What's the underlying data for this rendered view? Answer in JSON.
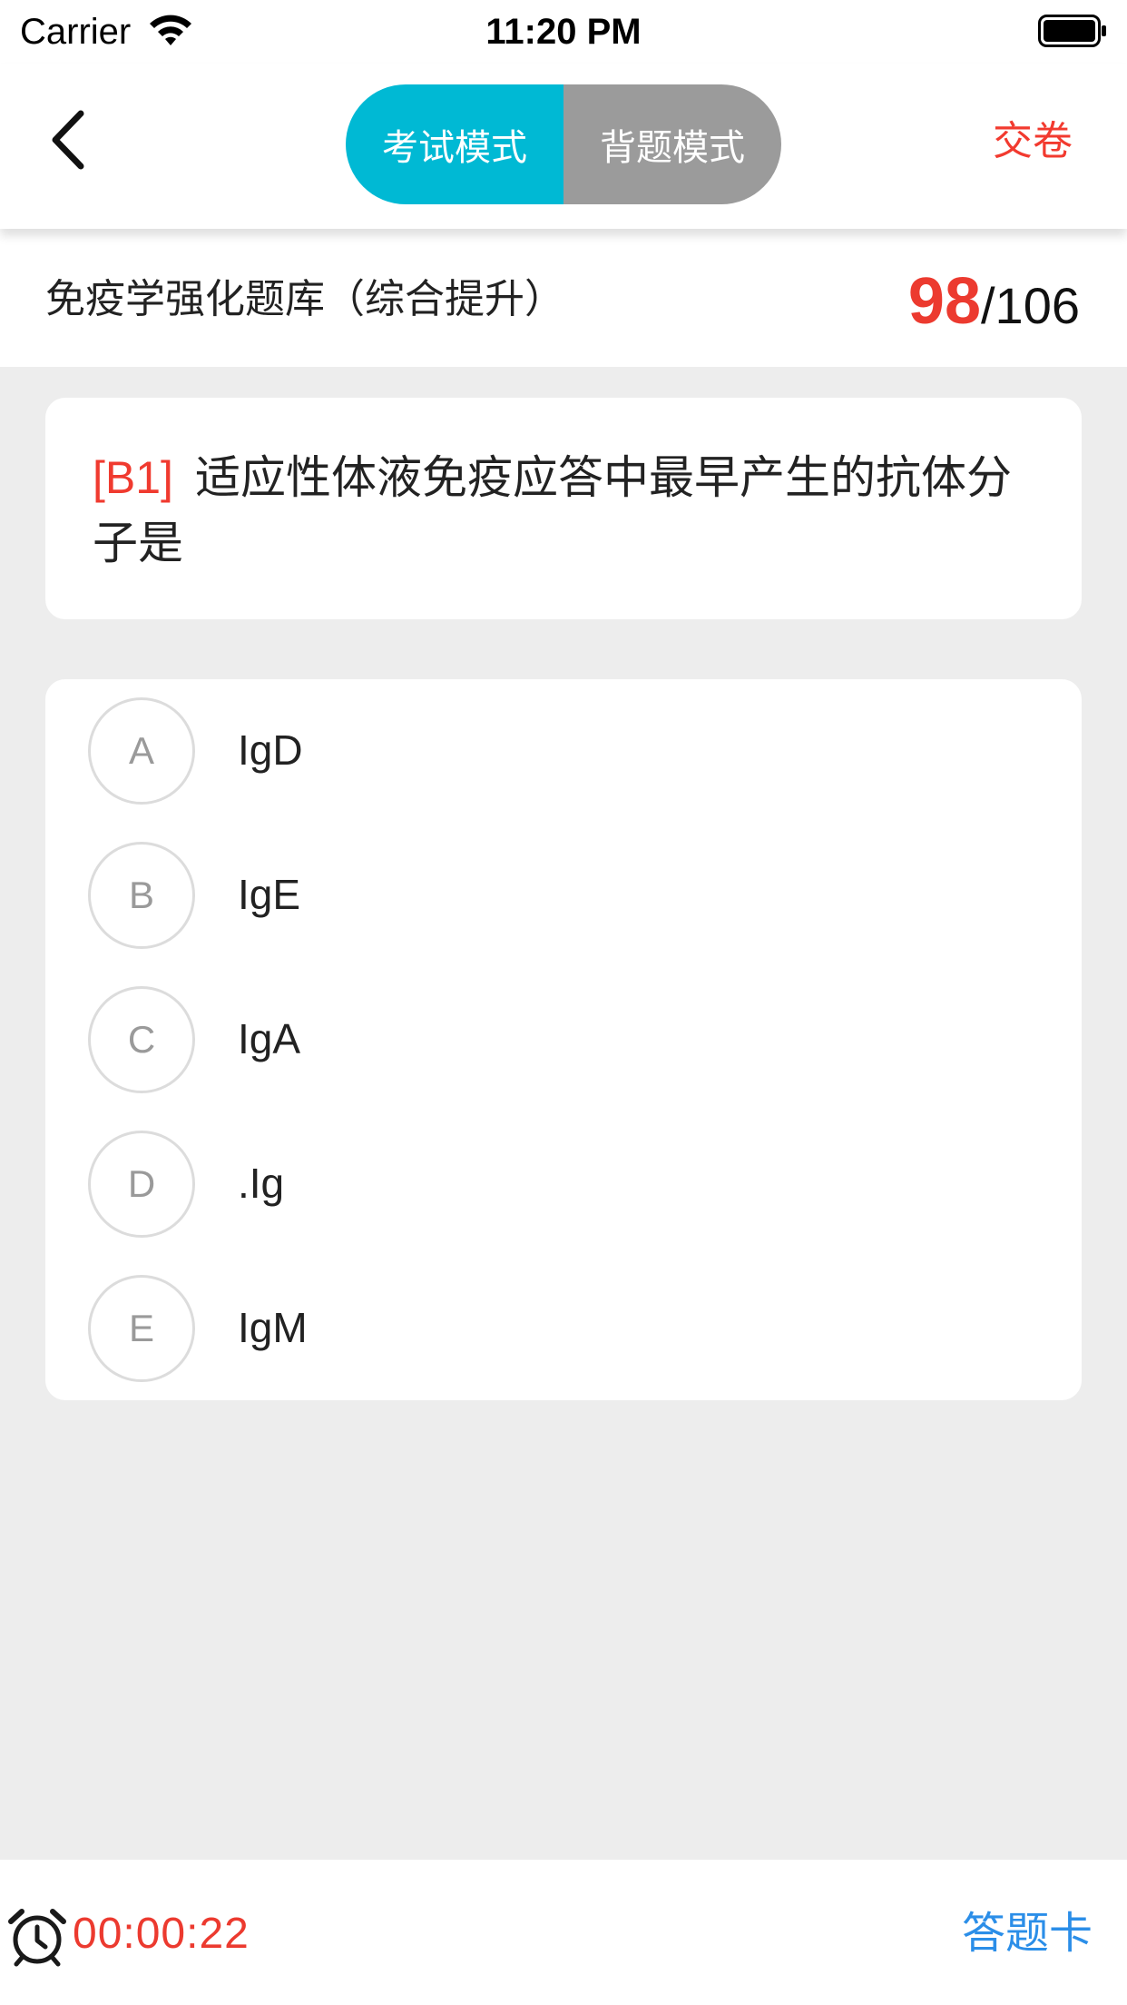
{
  "status_bar": {
    "carrier": "Carrier",
    "time": "11:20 PM",
    "icons": [
      "wifi-icon",
      "battery-icon"
    ]
  },
  "nav": {
    "back_icon": "chevron-left-icon",
    "modes": [
      {
        "label": "考试模式",
        "active": true
      },
      {
        "label": "背题模式",
        "active": false
      }
    ],
    "submit_label": "交卷"
  },
  "exam": {
    "bank_title": "免疫学强化题库（综合提升）",
    "current": "98",
    "total": "/106"
  },
  "question": {
    "type": "[B1]",
    "text": "适应性体液免疫应答中最早产生的抗体分子是"
  },
  "options": [
    {
      "letter": "A",
      "text": "IgD"
    },
    {
      "letter": "B",
      "text": "IgE"
    },
    {
      "letter": "C",
      "text": "IgA"
    },
    {
      "letter": "D",
      "text": ".Ig"
    },
    {
      "letter": "E",
      "text": "IgM"
    }
  ],
  "footer": {
    "timer_icon": "alarm-clock-icon",
    "timer": "00:00:22",
    "answer_card_label": "答题卡"
  },
  "colors": {
    "accent_active": "#00b9d4",
    "inactive_tab": "#9b9b9b",
    "red": "#ec3a2f",
    "link_blue": "#2b8ee8",
    "background": "#ededed"
  }
}
